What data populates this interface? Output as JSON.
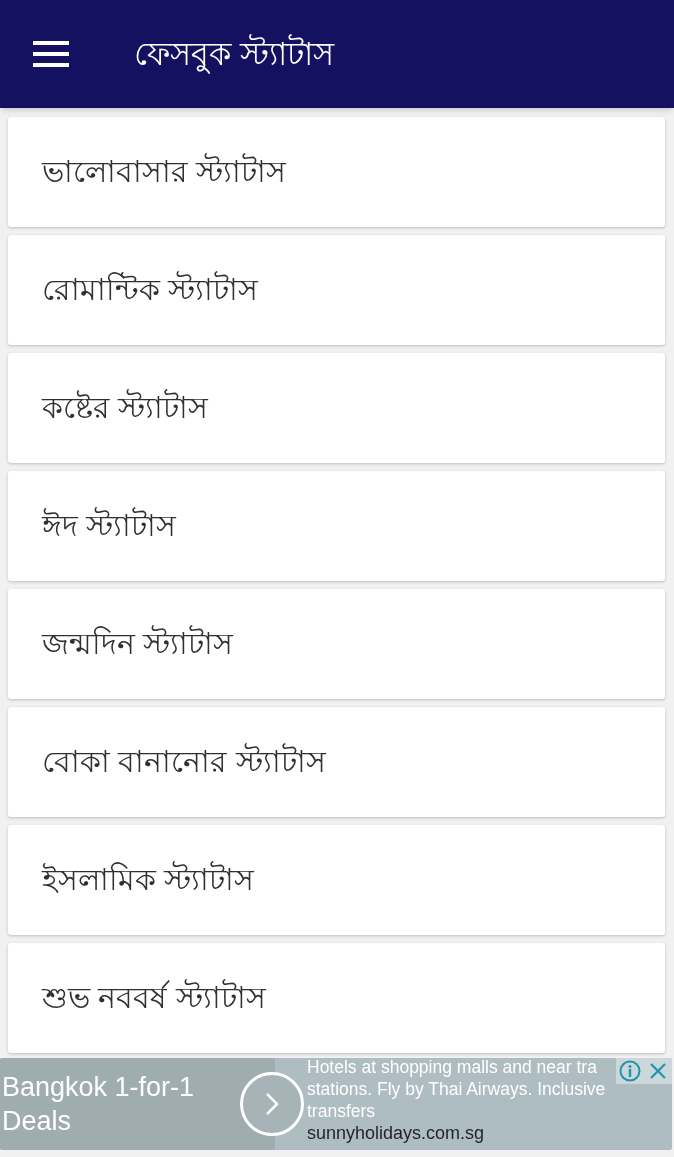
{
  "app_bar": {
    "title": "ফেসবুক স্ট্যাটাস"
  },
  "categories": [
    {
      "label": "ভালোবাসার স্ট্যাটাস"
    },
    {
      "label": "রোমান্টিক স্ট্যাটাস"
    },
    {
      "label": "কষ্টের স্ট্যাটাস"
    },
    {
      "label": "ঈদ স্ট্যাটাস"
    },
    {
      "label": "জন্মদিন স্ট্যাটাস"
    },
    {
      "label": "বোকা বানানোর স্ট্যাটাস"
    },
    {
      "label": "ইসলামিক স্ট্যাটাস"
    },
    {
      "label": "শুভ নববর্ষ স্ট্যাটাস"
    }
  ],
  "ad": {
    "headline": "Bangkok 1-for-1 Deals",
    "description": "Hotels at shopping malls and near tra stations. Fly by Thai Airways. Inclusive transfers",
    "url": "sunnyholidays.com.sg"
  }
}
